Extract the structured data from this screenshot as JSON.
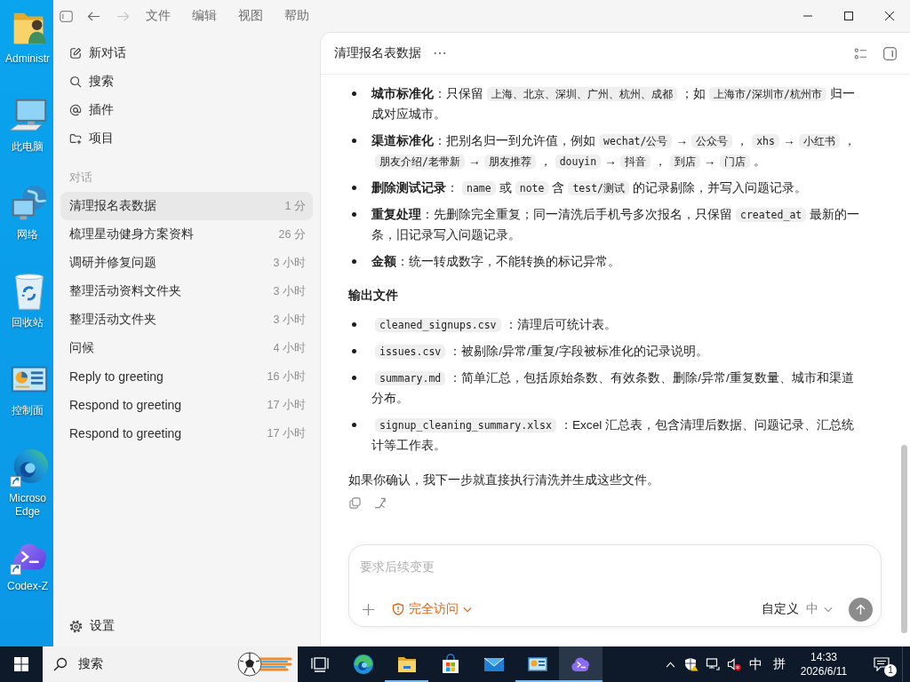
{
  "desktop": {
    "icons": [
      {
        "kind": "user-folder",
        "label": "Administr"
      },
      {
        "kind": "computer",
        "label": "此电脑"
      },
      {
        "kind": "network",
        "label": "网络"
      },
      {
        "kind": "recycle-bin",
        "label": "回收站"
      },
      {
        "kind": "control-panel",
        "label": "控制面"
      },
      {
        "kind": "edge",
        "label": "Microso Edge"
      },
      {
        "kind": "codex",
        "label": "Codex-Z"
      }
    ]
  },
  "window": {
    "toolbar": {
      "back": {
        "disabled": false
      },
      "forward": {
        "disabled": true
      },
      "menus": [
        "文件",
        "编辑",
        "视图",
        "帮助"
      ]
    },
    "sidebar": {
      "actions": [
        {
          "kind": "new-chat",
          "label": "新对话"
        },
        {
          "kind": "search",
          "label": "搜索"
        },
        {
          "kind": "plugins",
          "label": "插件"
        },
        {
          "kind": "projects",
          "label": "项目"
        }
      ],
      "section_label": "对话",
      "conversations": [
        {
          "title": "清理报名表数据",
          "time": "1 分",
          "selected": true
        },
        {
          "title": "梳理星动健身方案资料",
          "time": "26 分",
          "selected": false
        },
        {
          "title": "调研并修复问题",
          "time": "3 小时",
          "selected": false
        },
        {
          "title": "整理活动资料文件夹",
          "time": "3 小时",
          "selected": false
        },
        {
          "title": "整理活动文件夹",
          "time": "3 小时",
          "selected": false
        },
        {
          "title": "问候",
          "time": "4 小时",
          "selected": false
        },
        {
          "title": "Reply to greeting",
          "time": "16 小时",
          "selected": false
        },
        {
          "title": "Respond to greeting",
          "time": "17 小时",
          "selected": false
        },
        {
          "title": "Respond to greeting",
          "time": "17 小时",
          "selected": false
        }
      ],
      "settings_label": "设置"
    },
    "chat": {
      "title": "清理报名表数据",
      "blocks": [
        {
          "kind": "list",
          "items": [
            {
              "parts": [
                {
                  "kind": "text",
                  "text": "**城市标准化**：只保留"
                },
                {
                  "kind": "code",
                  "text": "上海、北京、深圳、广州、杭州、成都"
                },
                {
                  "kind": "text",
                  "text": "；如"
                },
                {
                  "kind": "code",
                  "text": "上海市/深圳市/杭州市"
                },
                {
                  "kind": "text",
                  "text": "归一成对应城市。"
                }
              ]
            },
            {
              "parts": [
                {
                  "kind": "text",
                  "text": "**渠道标准化**：把别名归一到允许值，例如"
                },
                {
                  "kind": "code",
                  "text": "wechat/公号"
                },
                {
                  "kind": "text",
                  "text": "→"
                },
                {
                  "kind": "code",
                  "text": "公众号"
                },
                {
                  "kind": "text",
                  "text": "，"
                },
                {
                  "kind": "code",
                  "text": "xhs"
                },
                {
                  "kind": "text",
                  "text": "→"
                },
                {
                  "kind": "code",
                  "text": "小红书"
                },
                {
                  "kind": "text",
                  "text": "，"
                },
                {
                  "kind": "code",
                  "text": "朋友介绍/老带新"
                },
                {
                  "kind": "text",
                  "text": "→"
                },
                {
                  "kind": "code",
                  "text": "朋友推荐"
                },
                {
                  "kind": "text",
                  "text": "，"
                },
                {
                  "kind": "code",
                  "text": "douyin"
                },
                {
                  "kind": "text",
                  "text": "→"
                },
                {
                  "kind": "code",
                  "text": "抖音"
                },
                {
                  "kind": "text",
                  "text": "，"
                },
                {
                  "kind": "code",
                  "text": "到店"
                },
                {
                  "kind": "text",
                  "text": "→"
                },
                {
                  "kind": "code",
                  "text": "门店"
                },
                {
                  "kind": "text",
                  "text": "。"
                }
              ]
            },
            {
              "parts": [
                {
                  "kind": "text",
                  "text": "**删除测试记录**："
                },
                {
                  "kind": "code",
                  "text": "name"
                },
                {
                  "kind": "text",
                  "text": "或"
                },
                {
                  "kind": "code",
                  "text": "note"
                },
                {
                  "kind": "text",
                  "text": "含"
                },
                {
                  "kind": "code",
                  "text": "test/测试"
                },
                {
                  "kind": "text",
                  "text": "的记录剔除，并写入问题记录。"
                }
              ]
            },
            {
              "parts": [
                {
                  "kind": "text",
                  "text": "**重复处理**：先删除完全重复；同一清洗后手机号多次报名，只保留"
                },
                {
                  "kind": "code",
                  "text": "created_at"
                },
                {
                  "kind": "text",
                  "text": "最新的一条，旧记录写入问题记录。"
                }
              ]
            },
            {
              "parts": [
                {
                  "kind": "text",
                  "text": "**金额**：统一转成数字，不能转换的标记异常。"
                }
              ]
            }
          ]
        },
        {
          "kind": "heading",
          "text": "输出文件"
        },
        {
          "kind": "list",
          "items": [
            {
              "parts": [
                {
                  "kind": "code",
                  "text": "cleaned_signups.csv"
                },
                {
                  "kind": "text",
                  "text": "：清理后可统计表。"
                }
              ]
            },
            {
              "parts": [
                {
                  "kind": "code",
                  "text": "issues.csv"
                },
                {
                  "kind": "text",
                  "text": "：被剔除/异常/重复/字段被标准化的记录说明。"
                }
              ]
            },
            {
              "parts": [
                {
                  "kind": "code",
                  "text": "summary.md"
                },
                {
                  "kind": "text",
                  "text": "：简单汇总，包括原始条数、有效条数、删除/异常/重复数量、城市和渠道分布。"
                }
              ]
            },
            {
              "parts": [
                {
                  "kind": "code",
                  "text": "signup_cleaning_summary.xlsx"
                },
                {
                  "kind": "text",
                  "text": "：Excel 汇总表，包含清理后数据、问题记录、汇总统计等工作表。"
                }
              ]
            }
          ]
        },
        {
          "kind": "paragraph",
          "text": "如果你确认，我下一步就直接执行清洗并生成这些文件。"
        }
      ],
      "composer": {
        "placeholder": "要求后续变更",
        "access": "完全访问",
        "model": "自定义",
        "effort": "中",
        "send": {
          "disabled": true
        }
      }
    }
  },
  "taskbar": {
    "search_placeholder": "搜索",
    "apps": [
      {
        "kind": "task-view",
        "running": false,
        "selected": false
      },
      {
        "kind": "edge",
        "running": false,
        "selected": false
      },
      {
        "kind": "explorer",
        "running": true,
        "selected": false
      },
      {
        "kind": "store",
        "running": false,
        "selected": false
      },
      {
        "kind": "mail",
        "running": false,
        "selected": false
      },
      {
        "kind": "control-panel",
        "running": true,
        "selected": false
      },
      {
        "kind": "codex",
        "running": true,
        "selected": true
      }
    ],
    "tray": {
      "ime_mode": "中",
      "ime_name": "拼",
      "time": "14:33",
      "date": "2026/6/11",
      "notifications": "1"
    }
  }
}
